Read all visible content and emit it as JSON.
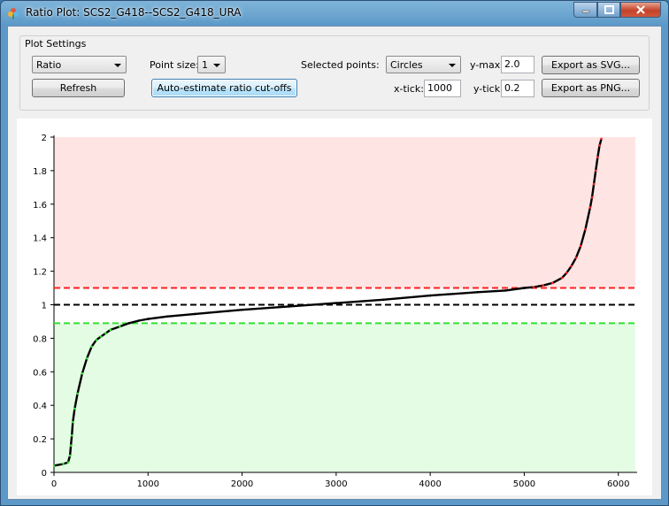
{
  "window": {
    "title": "Ratio Plot: SCS2_G418--SCS2_G418_URA",
    "app_icon": "qt-flower-icon",
    "controls": {
      "minimize": "minimize-icon",
      "maximize": "maximize-icon",
      "close": "close-icon"
    }
  },
  "settings": {
    "group_title": "Plot Settings",
    "mode_value": "Ratio",
    "point_size_label": "Point size:",
    "point_size_value": "1",
    "selected_points_label": "Selected points:",
    "selected_points_value": "Circles",
    "ymax_label": "y-max:",
    "ymax_value": "2.0",
    "xtick_label": "x-tick:",
    "xtick_value": "1000",
    "ytick_label": "y-tick:",
    "ytick_value": "0.2",
    "refresh_label": "Refresh",
    "auto_estimate_label": "Auto-estimate ratio cut-offs",
    "export_svg_label": "Export as SVG...",
    "export_png_label": "Export as PNG..."
  },
  "chart_data": {
    "type": "line",
    "x_range": [
      0,
      6200
    ],
    "y_range": [
      0,
      2
    ],
    "x_ticks": [
      "0",
      "1000",
      "2000",
      "3000",
      "4000",
      "5000",
      "6000"
    ],
    "y_ticks": [
      "0",
      "0.2",
      "0.4",
      "0.6",
      "0.8",
      "1",
      "1.2",
      "1.4",
      "1.6",
      "1.8",
      "2"
    ],
    "x_tick_values": [
      0,
      1000,
      2000,
      3000,
      4000,
      5000,
      6000
    ],
    "y_tick_values": [
      0,
      0.2,
      0.4,
      0.6,
      0.8,
      1,
      1.2,
      1.4,
      1.6,
      1.8,
      2
    ],
    "upper_cutoff": 1.1,
    "lower_cutoff": 0.89,
    "reference_line": 1.0,
    "data_x_max": 5820,
    "upper_region_color": "#ffe4e4",
    "lower_region_color": "#e4fce4",
    "upper_line_color": "#ff2020",
    "lower_line_color": "#30e030",
    "reference_line_color": "#000000",
    "series": [
      {
        "color": "#000000",
        "x": [
          0,
          100,
          150,
          170,
          180,
          190,
          200,
          220,
          250,
          300,
          350,
          400,
          450,
          500,
          550,
          600,
          700,
          800,
          900,
          1000,
          1200,
          1500,
          2000,
          2500,
          3000,
          3500,
          4000,
          4500,
          4800,
          5000,
          5100,
          5200,
          5300,
          5400,
          5450,
          5500,
          5550,
          5600,
          5650,
          5700,
          5720,
          5740,
          5760,
          5780,
          5800,
          5820
        ],
        "y": [
          0.04,
          0.05,
          0.06,
          0.1,
          0.16,
          0.22,
          0.3,
          0.38,
          0.47,
          0.59,
          0.68,
          0.75,
          0.79,
          0.81,
          0.83,
          0.85,
          0.87,
          0.89,
          0.905,
          0.915,
          0.93,
          0.945,
          0.97,
          0.99,
          1.01,
          1.03,
          1.055,
          1.075,
          1.085,
          1.1,
          1.105,
          1.115,
          1.13,
          1.16,
          1.19,
          1.23,
          1.28,
          1.35,
          1.45,
          1.58,
          1.64,
          1.72,
          1.8,
          1.88,
          1.95,
          1.99
        ]
      }
    ]
  }
}
